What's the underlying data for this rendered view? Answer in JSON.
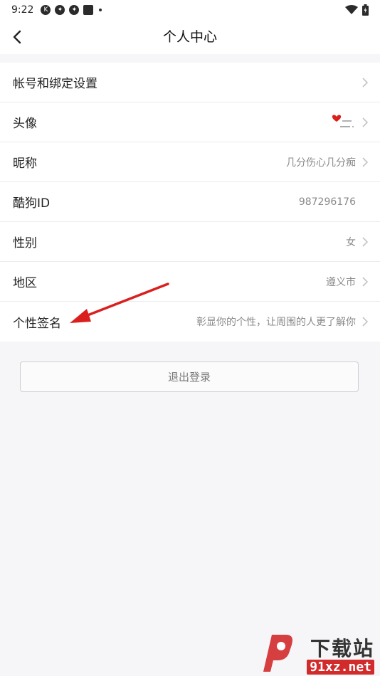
{
  "status_bar": {
    "time": "9:22",
    "k_icon": "K"
  },
  "header": {
    "title": "个人中心"
  },
  "rows": [
    {
      "label": "帐号和绑定设置",
      "value": "",
      "has_arrow": true
    },
    {
      "label": "头像",
      "value": "",
      "has_arrow": true,
      "has_avatar": true
    },
    {
      "label": "昵称",
      "value": "几分伤心几分痴",
      "has_arrow": true
    },
    {
      "label": "酷狗ID",
      "value": "987296176",
      "has_arrow": false
    },
    {
      "label": "性别",
      "value": "女",
      "has_arrow": true
    },
    {
      "label": "地区",
      "value": "遵义市",
      "has_arrow": true
    },
    {
      "label": "个性签名",
      "value": "彰显你的个性，让周围的人更了解你",
      "has_arrow": true
    }
  ],
  "logout_label": "退出登录",
  "watermark": {
    "text": "下载站",
    "url": "91xz.net"
  },
  "colors": {
    "arrow_red": "#d9201f",
    "background": "#f6f6f8",
    "row_bg": "#ffffff"
  }
}
